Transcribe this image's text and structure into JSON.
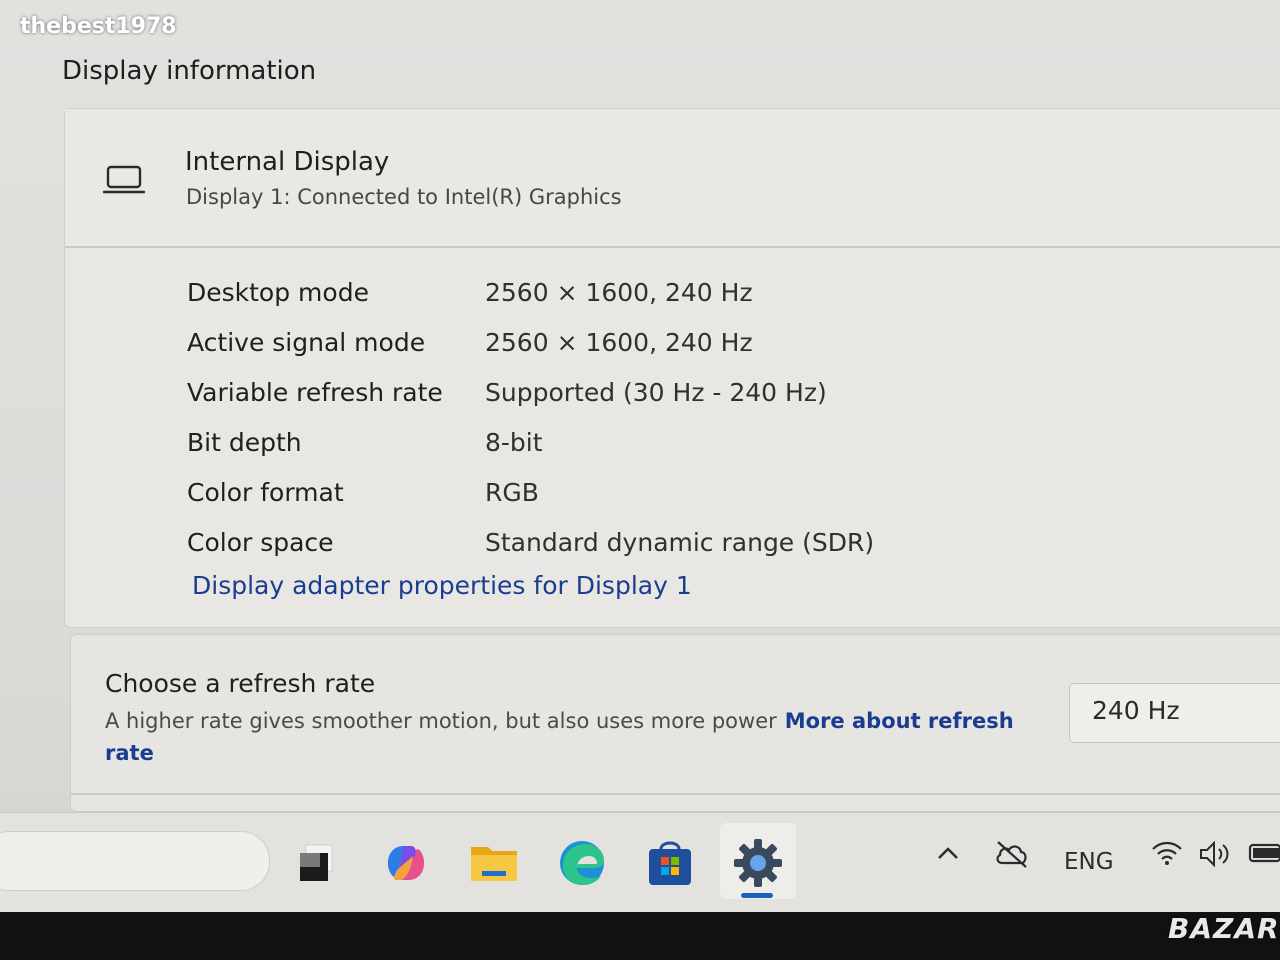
{
  "watermark": "thebest1978",
  "section_title": "Display information",
  "display": {
    "name": "Internal Display",
    "subtitle": "Display 1: Connected to Intel(R) Graphics"
  },
  "info_rows": [
    {
      "label": "Desktop mode",
      "value": "2560 × 1600, 240 Hz"
    },
    {
      "label": "Active signal mode",
      "value": "2560 × 1600, 240 Hz"
    },
    {
      "label": "Variable refresh rate",
      "value": "Supported (30 Hz - 240 Hz)"
    },
    {
      "label": "Bit depth",
      "value": "8-bit"
    },
    {
      "label": "Color format",
      "value": "RGB"
    },
    {
      "label": "Color space",
      "value": "Standard dynamic range (SDR)"
    }
  ],
  "adapter_link": "Display adapter properties for Display 1",
  "refresh": {
    "title": "Choose a refresh rate",
    "description": "A higher rate gives smoother motion, but also uses more power",
    "link": "More about refresh rate",
    "selected": "240 Hz"
  },
  "taskbar": {
    "apps": [
      "task-view",
      "copilot",
      "file-explorer",
      "edge",
      "store",
      "settings"
    ],
    "active_app": "settings",
    "language": "ENG"
  },
  "corner_logo": "BAZAR",
  "colors": {
    "accent_link": "#1a3d8f",
    "active_indicator": "#1f5fbf"
  }
}
